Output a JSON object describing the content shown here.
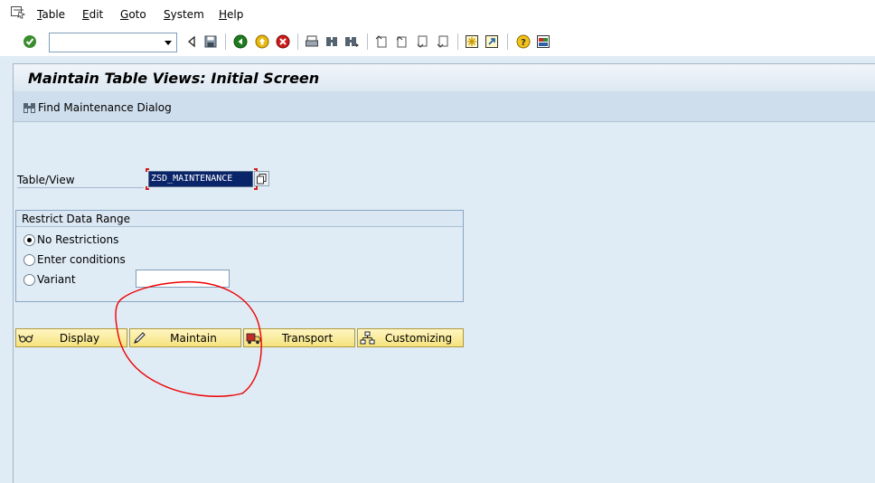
{
  "menubar": {
    "items": [
      "Table",
      "Edit",
      "Goto",
      "System",
      "Help"
    ]
  },
  "toolbar": {
    "command_field_value": "",
    "icons": [
      "enter-icon",
      "back-icon",
      "save-icon",
      "green-back-icon",
      "exit-icon",
      "cancel-icon",
      "print-icon",
      "find-icon",
      "find-next-icon",
      "first-page-icon",
      "previous-page-icon",
      "next-page-icon",
      "last-page-icon",
      "create-session-icon",
      "shortcut-icon",
      "help-icon",
      "customize-layout-icon"
    ]
  },
  "page": {
    "title": "Maintain Table Views: Initial Screen"
  },
  "app_toolbar": {
    "find_maintenance_dialog": "Find Maintenance Dialog"
  },
  "form": {
    "table_view_label": "Table/View",
    "table_view_value": "ZSD_MAINTENANCE"
  },
  "restrict": {
    "title": "Restrict Data Range",
    "options": [
      "No Restrictions",
      "Enter conditions",
      "Variant"
    ],
    "selected": "No Restrictions",
    "variant_value": ""
  },
  "actions": {
    "display": "Display",
    "maintain": "Maintain",
    "transport": "Transport",
    "customizing": "Customizing"
  },
  "colors": {
    "background": "#dfebf5",
    "button_fill": "#f5e27d",
    "selected_field": "#0a246a",
    "annotation_circle": "#ee0000"
  }
}
